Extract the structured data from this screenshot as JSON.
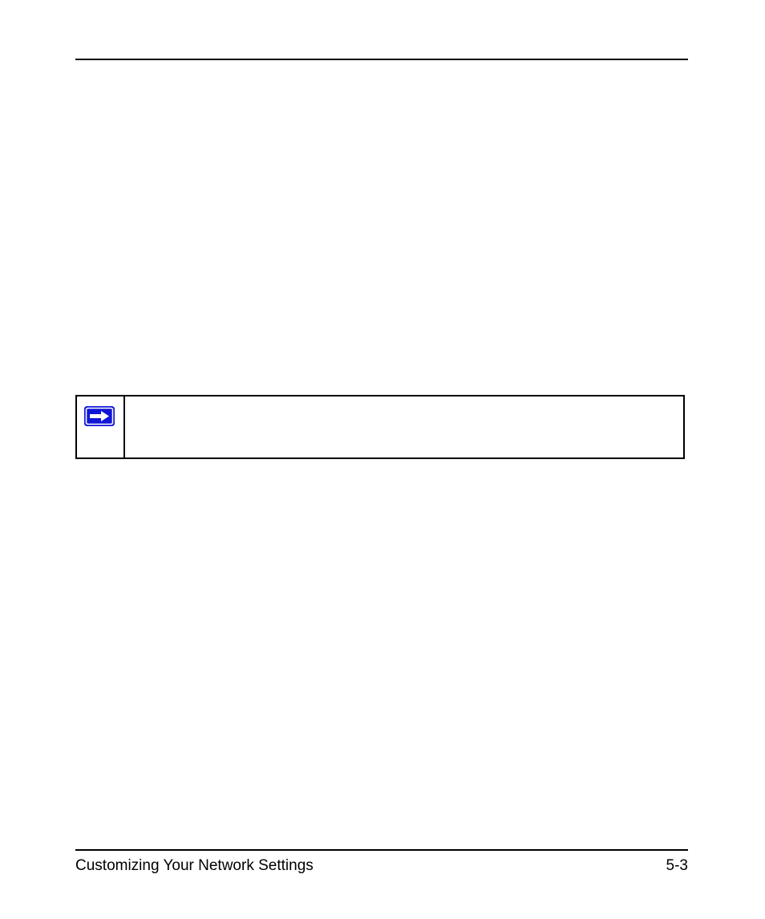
{
  "footer": {
    "left": "Customizing Your Network Settings",
    "right": "5-3"
  },
  "note": {
    "icon_name": "arrow-right-icon",
    "text": ""
  }
}
